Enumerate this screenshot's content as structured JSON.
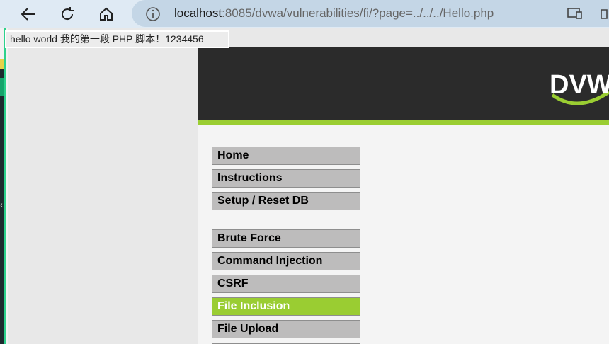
{
  "browser": {
    "url_host": "localhost",
    "url_rest": ":8085/dvwa/vulnerabilities/fi/?page=../../../Hello.php"
  },
  "output": {
    "text": "hello world 我的第一段 PHP 脚本！1234456"
  },
  "dvwa": {
    "logo_text": "DVWA",
    "menu_main": [
      "Home",
      "Instructions",
      "Setup / Reset DB"
    ],
    "menu_vulns": [
      "Brute Force",
      "Command Injection",
      "CSRF",
      "File Inclusion",
      "File Upload"
    ],
    "selected_item": "File Inclusion",
    "accent_color": "#9acd32"
  }
}
